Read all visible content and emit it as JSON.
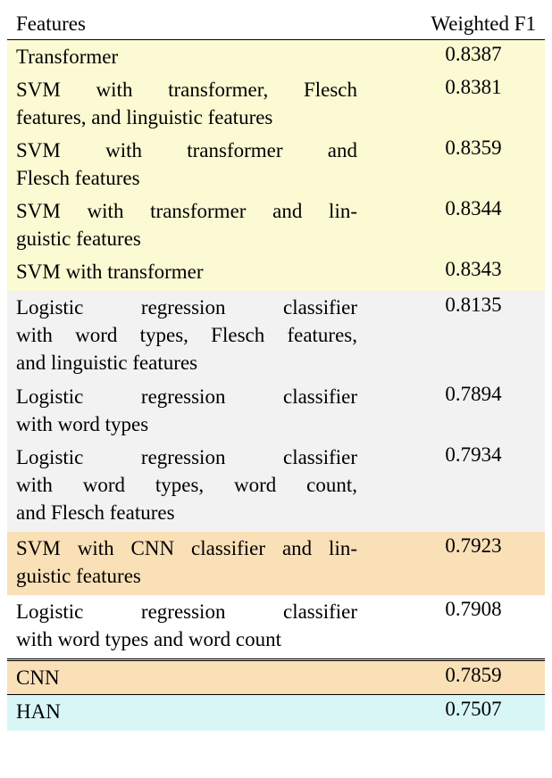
{
  "chart_data": {
    "type": "table",
    "headers": [
      "Features",
      "Weighted F1"
    ],
    "groups": [
      {
        "bg": "yellow",
        "rows": [
          {
            "feature": "Transformer",
            "f1": "0.8387"
          },
          {
            "feature": "SVM with transformer, Flesch features, and linguistic features",
            "f1": "0.8381"
          },
          {
            "feature": "SVM with transformer and Flesch features",
            "f1": "0.8359"
          },
          {
            "feature": "SVM with transformer and linguistic features",
            "f1": "0.8344"
          },
          {
            "feature": "SVM with transformer",
            "f1": "0.8343"
          }
        ]
      },
      {
        "bg": "gray",
        "rows": [
          {
            "feature": "Logistic regression classifier with word types, Flesch features, and linguistic features",
            "f1": "0.8135"
          },
          {
            "feature": "Logistic regression classifier with word types",
            "f1": "0.7894"
          },
          {
            "feature": "Logistic regression classifier with word types, word count, and Flesch features",
            "f1": "0.7934"
          }
        ]
      },
      {
        "bg": "orange",
        "rows": [
          {
            "feature": "SVM with CNN classifier and linguistic features",
            "f1": "0.7923"
          }
        ]
      },
      {
        "bg": "white",
        "rows": [
          {
            "feature": "Logistic regression classifier with word types and word count",
            "f1": "0.7908"
          }
        ]
      }
    ],
    "bottom_section": [
      {
        "feature": "CNN",
        "f1": "0.7859",
        "bg": "orange"
      },
      {
        "feature": "HAN",
        "f1": "0.7507",
        "bg": "cyan"
      }
    ]
  }
}
